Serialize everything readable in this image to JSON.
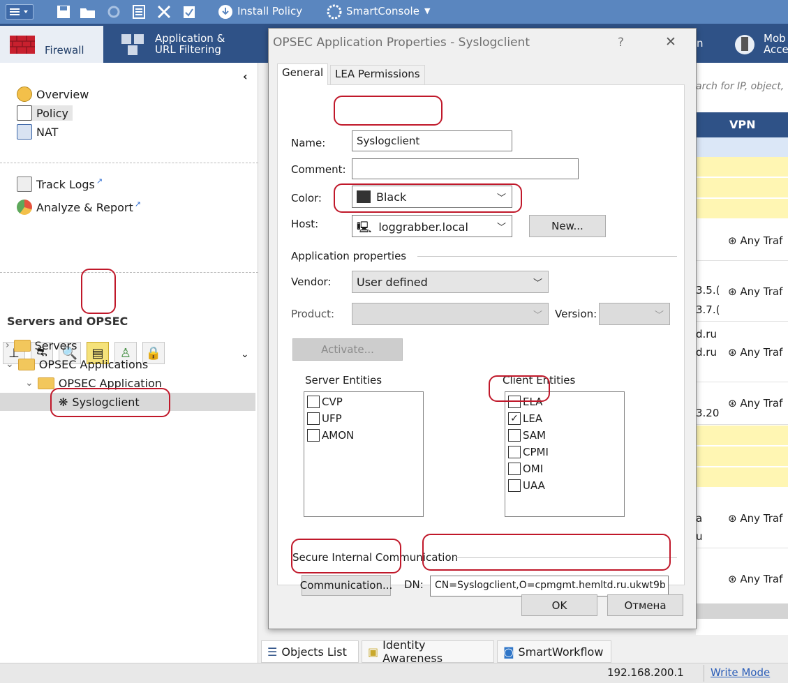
{
  "topbar": {
    "install_policy": "Install Policy",
    "smartconsole": "SmartConsole"
  },
  "tabs": [
    {
      "label": "Firewall"
    },
    {
      "label1": "Application &",
      "label2": "URL Filtering"
    },
    {
      "label": "n"
    },
    {
      "label1": "Mob",
      "label2": "Acce"
    }
  ],
  "left": {
    "nav": [
      "Overview",
      "Policy",
      "NAT"
    ],
    "logs": [
      "Track Logs",
      "Analyze & Report"
    ],
    "section_title": "Servers and OPSEC",
    "tree": {
      "servers": "Servers",
      "opsec_apps": "OPSEC Applications",
      "opsec_app": "OPSEC Application",
      "selected": "Syslogclient"
    }
  },
  "right": {
    "search_placeholder": "arch for IP, object,",
    "vpn_header": "VPN",
    "any_traffic": "Any Traf",
    "partials": [
      "3.5.(",
      "3.7.(",
      "d.ru",
      "d.ru",
      "3.20",
      "a",
      "u"
    ]
  },
  "dialog": {
    "title": "OPSEC Application Properties - Syslogclient",
    "help": "?",
    "close": "✕",
    "tabs": [
      "General",
      "LEA Permissions"
    ],
    "name_label": "Name:",
    "name_value": "Syslogclient",
    "comment_label": "Comment:",
    "comment_value": "",
    "color_label": "Color:",
    "color_value": "Black",
    "host_label": "Host:",
    "host_value": "loggrabber.local",
    "new_button": "New...",
    "app_props": "Application properties",
    "vendor_label": "Vendor:",
    "vendor_value": "User defined",
    "product_label": "Product:",
    "version_label": "Version:",
    "activate_button": "Activate...",
    "server_entities_label": "Server Entities",
    "server_entities": [
      {
        "label": "CVP",
        "checked": false
      },
      {
        "label": "UFP",
        "checked": false
      },
      {
        "label": "AMON",
        "checked": false
      }
    ],
    "client_entities_label": "Client Entities",
    "client_entities": [
      {
        "label": "ELA",
        "checked": false
      },
      {
        "label": "LEA",
        "checked": true
      },
      {
        "label": "SAM",
        "checked": false
      },
      {
        "label": "CPMI",
        "checked": false
      },
      {
        "label": "OMI",
        "checked": false
      },
      {
        "label": "UAA",
        "checked": false
      }
    ],
    "sic_label": "Secure Internal Communication",
    "communication_button": "Communication...",
    "dn_label": "DN:",
    "dn_value": "CN=Syslogclient,O=cpmgmt.hemltd.ru.ukwt9b",
    "ok_button": "OK",
    "cancel_button": "Отмена"
  },
  "bottom_tabs": [
    "Objects List",
    "Identity Awareness",
    "SmartWorkflow"
  ],
  "status": {
    "ip": "192.168.200.1",
    "mode": "Write Mode"
  }
}
